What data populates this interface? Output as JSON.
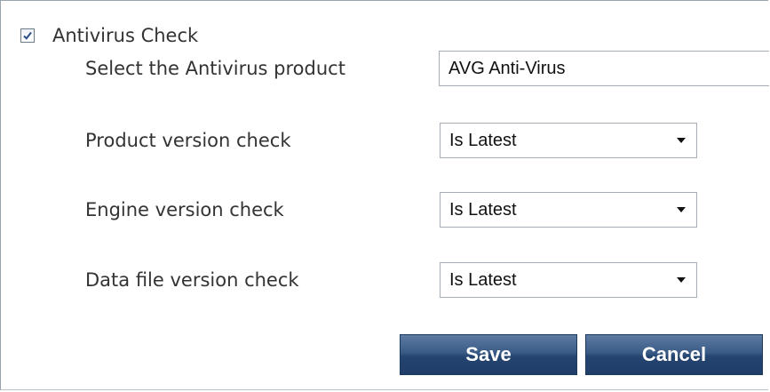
{
  "antivirus_check": {
    "label": "Antivirus Check",
    "checked": true
  },
  "form": {
    "product": {
      "label": "Select the Antivirus product",
      "value": "AVG Anti-Virus"
    },
    "product_version": {
      "label": "Product version check",
      "value": "Is Latest"
    },
    "engine_version": {
      "label": "Engine version check",
      "value": "Is Latest"
    },
    "data_file_version": {
      "label": "Data file version check",
      "value": "Is Latest"
    }
  },
  "buttons": {
    "save": "Save",
    "cancel": "Cancel"
  },
  "icons": {
    "checkbox": "checkmark-icon",
    "dropdown": "chevron-down-icon"
  },
  "colors": {
    "button_bg": "#2a4a76",
    "border": "#a5acb3",
    "text": "#333333"
  }
}
